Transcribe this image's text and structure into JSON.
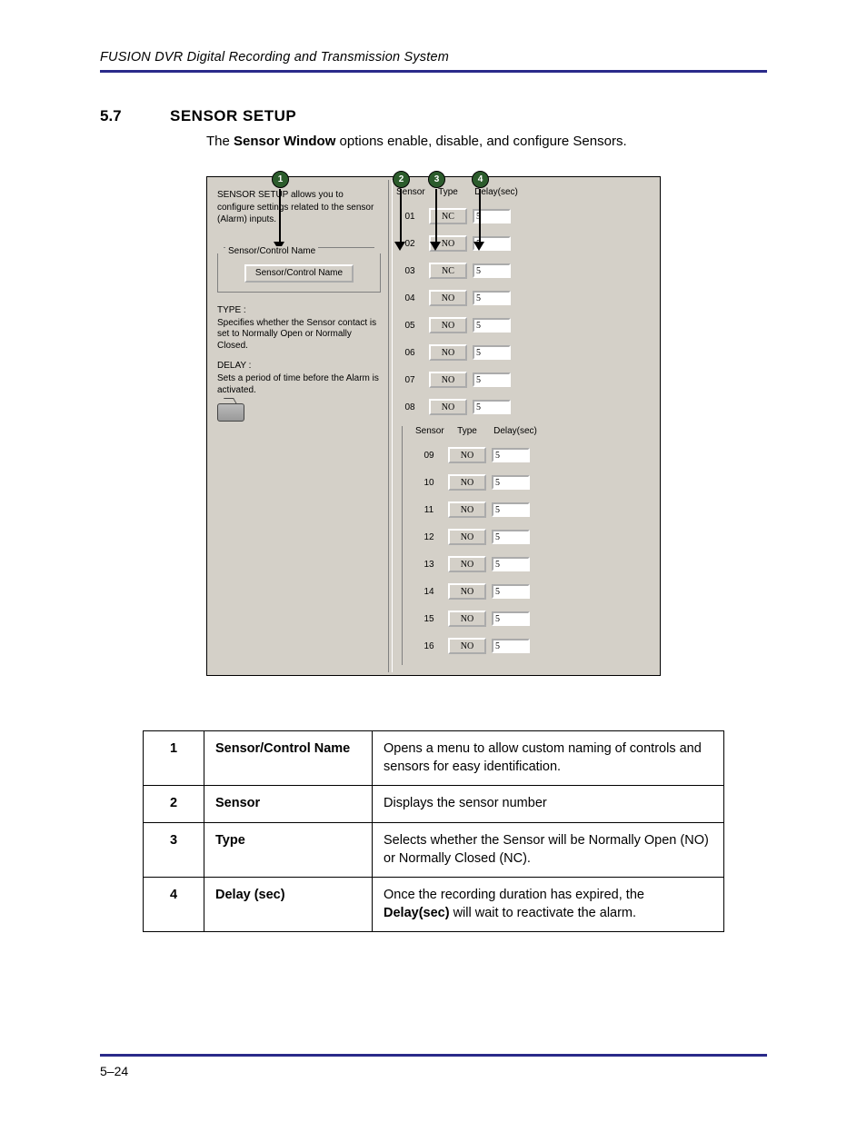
{
  "header": {
    "running": "FUSION DVR Digital Recording and Transmission System"
  },
  "section": {
    "num": "5.7",
    "title": "SENSOR SETUP"
  },
  "intro": {
    "pre": "The ",
    "bold": "Sensor Window",
    "post": " options enable, disable, and configure Sensors."
  },
  "callouts": {
    "c1": "1",
    "c2": "2",
    "c3": "3",
    "c4": "4"
  },
  "panel": {
    "caption": "SENSOR SETUP allows you to configure settings related to the sensor (Alarm) inputs.",
    "group_legend": "Sensor/Control Name",
    "group_button": "Sensor/Control Name",
    "type_h": "TYPE :",
    "type_b": "Specifies whether the Sensor contact is set to Normally Open or Normally Closed.",
    "delay_h": "DELAY :",
    "delay_b": "Sets a period of time before the Alarm is activated.",
    "col_sensor": "Sensor",
    "col_type": "Type",
    "col_delay": "Delay(sec)",
    "rows_left": [
      {
        "n": "01",
        "t": "NC",
        "d": "5"
      },
      {
        "n": "02",
        "t": "NO",
        "d": "5"
      },
      {
        "n": "03",
        "t": "NC",
        "d": "5"
      },
      {
        "n": "04",
        "t": "NO",
        "d": "5"
      },
      {
        "n": "05",
        "t": "NO",
        "d": "5"
      },
      {
        "n": "06",
        "t": "NO",
        "d": "5"
      },
      {
        "n": "07",
        "t": "NO",
        "d": "5"
      },
      {
        "n": "08",
        "t": "NO",
        "d": "5"
      }
    ],
    "rows_right": [
      {
        "n": "09",
        "t": "NO",
        "d": "5"
      },
      {
        "n": "10",
        "t": "NO",
        "d": "5"
      },
      {
        "n": "11",
        "t": "NO",
        "d": "5"
      },
      {
        "n": "12",
        "t": "NO",
        "d": "5"
      },
      {
        "n": "13",
        "t": "NO",
        "d": "5"
      },
      {
        "n": "14",
        "t": "NO",
        "d": "5"
      },
      {
        "n": "15",
        "t": "NO",
        "d": "5"
      },
      {
        "n": "16",
        "t": "NO",
        "d": "5"
      }
    ]
  },
  "ref": [
    {
      "i": "1",
      "term": "Sensor/Control Name",
      "desc": "Opens a menu to allow custom naming of controls and sensors for easy identification."
    },
    {
      "i": "2",
      "term": "Sensor",
      "desc": "Displays the sensor number"
    },
    {
      "i": "3",
      "term": "Type",
      "desc": "Selects whether the Sensor will be Normally Open (NO) or Normally Closed (NC)."
    },
    {
      "i": "4",
      "term": "Delay (sec)",
      "desc_pre": "Once the recording duration has expired, the ",
      "desc_bold": "Delay(sec)",
      "desc_post": " will wait to reactivate the alarm."
    }
  ],
  "footer": {
    "pagenum": "5–24"
  }
}
